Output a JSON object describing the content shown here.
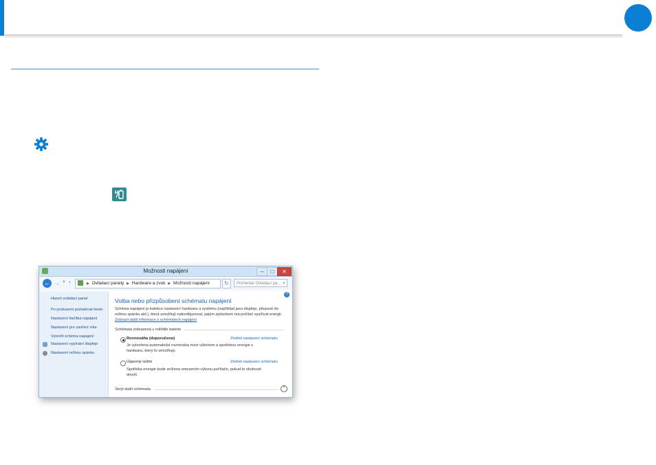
{
  "colors": {
    "accent": "#0b7fd4",
    "battery_icon": "#2f8a8f"
  },
  "icons": {
    "settings": "gear-icon",
    "battery": "battery-plug-icon"
  },
  "window": {
    "title": "Možnosti napájení",
    "buttons": {
      "minimize": "–",
      "maximize": "□",
      "close": "✕"
    },
    "nav": {
      "back": "←",
      "forward": "→",
      "up": "↑",
      "refresh": "↻",
      "breadcrumb": [
        "Ovládací panely",
        "Hardware a zvuk",
        "Možnosti napájení"
      ],
      "search_placeholder": "Prohledat Ovládací pa..."
    },
    "sidebar": {
      "items": [
        "Hlavní ovládací panel",
        "Po probuzení požadovat heslo",
        "Nastavení tlačítka napájení",
        "Nastavení pro zavření víka",
        "Vytvořit schéma napájení",
        "Nastavení vypínání displeje",
        "Nastavení režimu spánku"
      ]
    },
    "main": {
      "heading": "Volba nebo přizpůsobení schématu napájení",
      "description": "Schéma napájení je kolekce nastavení hardwaru a systému (například jasu displeje, přepnutí do režimu spánku atd.), která umožňují nakonfigurovat, jakým způsobem má počítač využívat energii.",
      "description_link": "Zobrazit další informace o schématech napájení",
      "group_label": "Schémata zobrazená u měřidle baterie",
      "plans": [
        {
          "name": "Rovnováha (doporučeno)",
          "selected": true,
          "link": "Změnit nastavení schématu",
          "description": "Je vytvořena automatická rovnováha mezi výkonem a spotřebou energie v hardwaru, který to umožňuje."
        },
        {
          "name": "Úsporný režim",
          "selected": false,
          "link": "Změnit nastavení schématu",
          "description": "Spotřeba energie bude snížena omezením výkonu počítače, pokud to okolnosti dovolí."
        }
      ],
      "hide_more": "Skrýt další schémata",
      "hide_icon": "^",
      "help_icon": "?"
    }
  }
}
